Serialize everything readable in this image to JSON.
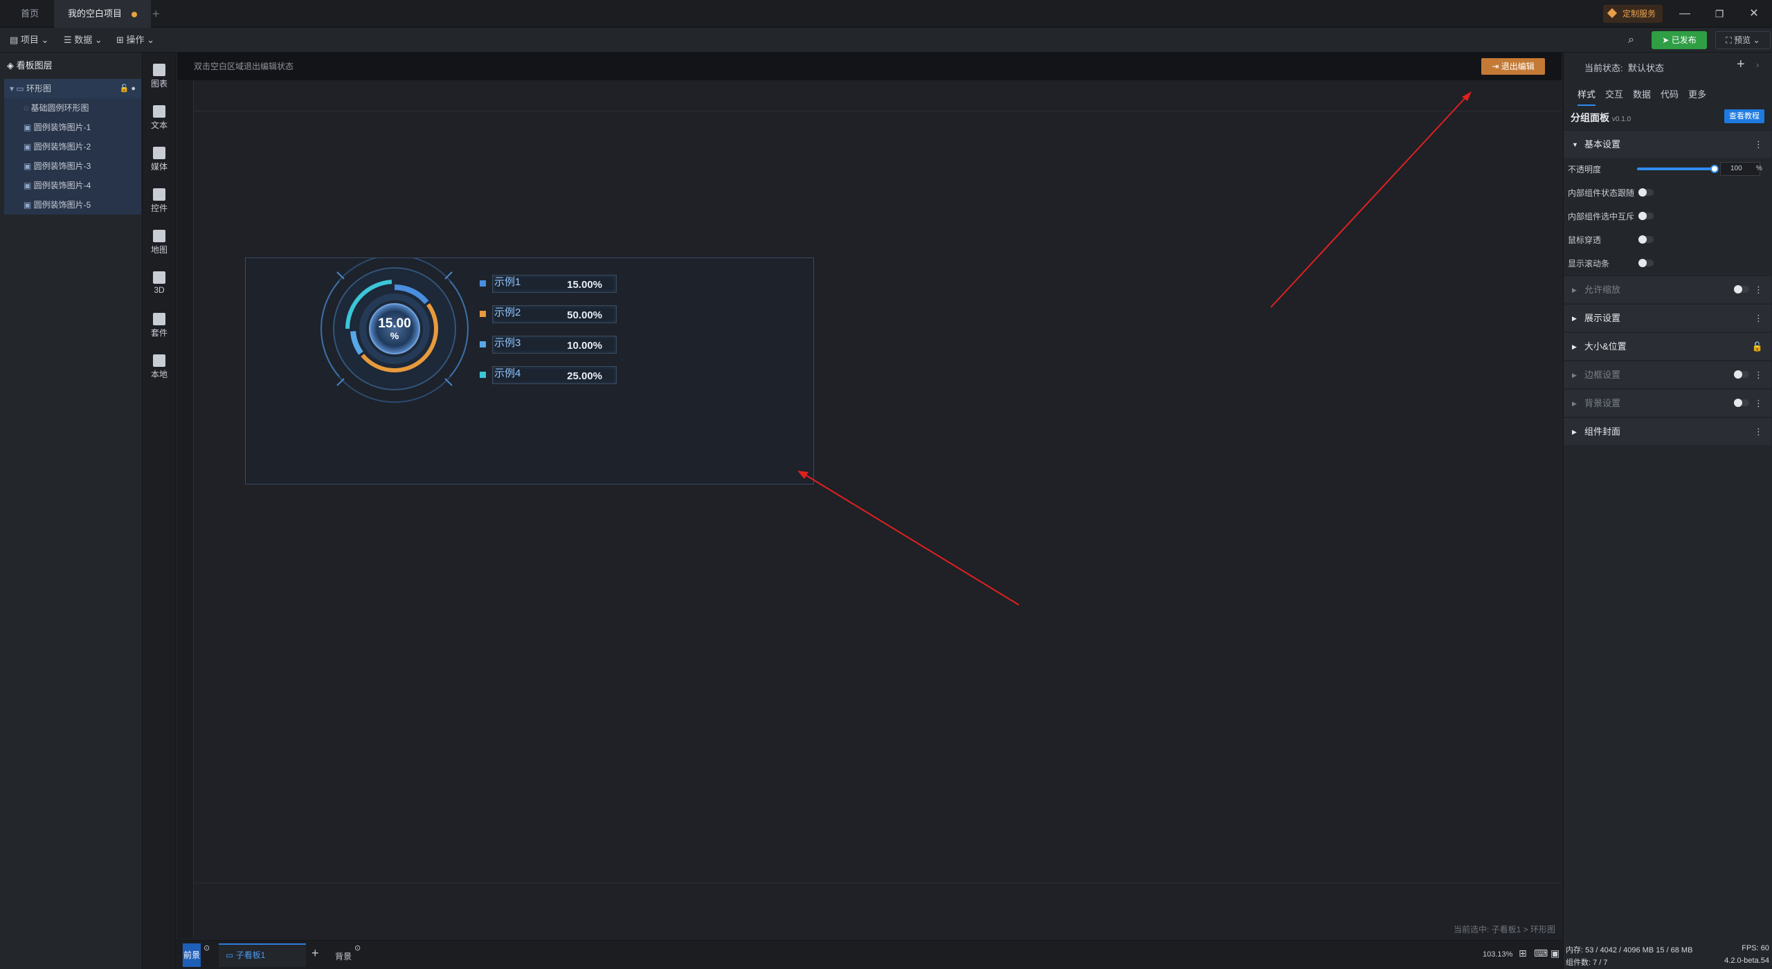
{
  "titlebar": {
    "tabs": [
      "首页",
      "我的空白项目"
    ],
    "add_tab": "+",
    "custom_service": "定制服务",
    "window_controls": [
      "—",
      "❐",
      "✕"
    ]
  },
  "toolbar": {
    "menus": [
      "项目",
      "数据",
      "操作"
    ],
    "publish_label": "已发布",
    "preview_label": "预览"
  },
  "layers": {
    "title": "看板图层",
    "items": [
      {
        "label": "环形图",
        "level": 0
      },
      {
        "label": "基础圆例环形图",
        "level": 1
      },
      {
        "label": "圆例装饰图片-1",
        "level": 1
      },
      {
        "label": "圆例装饰图片-2",
        "level": 1
      },
      {
        "label": "圆例装饰图片-3",
        "level": 1
      },
      {
        "label": "圆例装饰图片-4",
        "level": 1
      },
      {
        "label": "圆例装饰图片-5",
        "level": 1
      }
    ]
  },
  "components": [
    "图表",
    "文本",
    "媒体",
    "控件",
    "地图",
    "3D",
    "套件",
    "本地"
  ],
  "canvas": {
    "hint": "双击空白区域退出编辑状态",
    "exit_edit": "退出编辑",
    "status_path": "当前选中: 子看板1 > 环形图"
  },
  "donut": {
    "center_value": "15.00",
    "center_unit": "%",
    "legend": [
      {
        "name": "示例1",
        "value": "15.00%",
        "color": "#4a8ee0"
      },
      {
        "name": "示例2",
        "value": "50.00%",
        "color": "#e89a3c"
      },
      {
        "name": "示例3",
        "value": "10.00%",
        "color": "#58a8e8"
      },
      {
        "name": "示例4",
        "value": "25.00%",
        "color": "#3cc6d8"
      }
    ]
  },
  "bottombar": {
    "front_label": "前景",
    "board_tab": "子看板1",
    "add": "+",
    "background_label": "背景",
    "zoom": "103.13%"
  },
  "rpanel": {
    "state_label": "当前状态:",
    "state_value": "默认状态",
    "tabs": [
      "样式",
      "交互",
      "数据",
      "代码",
      "更多"
    ],
    "component_name": "分组面板",
    "version": "v0.1.0",
    "tutorial_button": "查看教程",
    "basic_settings": "基本设置",
    "opacity_label": "不透明度",
    "opacity_value": "100",
    "opacity_unit": "%",
    "opacity_level": 1.0,
    "rows": [
      "内部组件状态跟随",
      "内部组件选中互斥",
      "鼠标穿透",
      "显示滚动条"
    ],
    "sections": [
      {
        "label": "允许缩放",
        "dim": true
      },
      {
        "label": "展示设置",
        "dim": false
      },
      {
        "label": "大小&位置",
        "dim": false
      },
      {
        "label": "边框设置",
        "dim": true
      },
      {
        "label": "背景设置",
        "dim": true
      },
      {
        "label": "组件封面",
        "dim": false
      }
    ]
  },
  "footer": {
    "memory": "内存: 53 / 4042 / 4096 MB 15 / 68 MB",
    "fps": "FPS: 60",
    "count": "组件数: 7 / 7",
    "version": "4.2.0-beta.54"
  }
}
